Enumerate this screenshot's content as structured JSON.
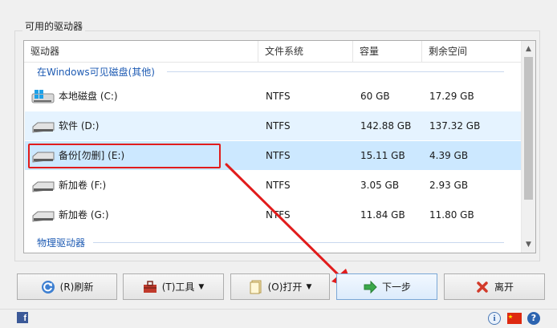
{
  "groupbox": {
    "title": "可用的驱动器"
  },
  "columns": {
    "drive": "驱动器",
    "filesystem": "文件系统",
    "capacity": "容量",
    "free": "剩余空间"
  },
  "groups": {
    "windows": "在Windows可见磁盘(其他)",
    "physical": "物理驱动器"
  },
  "drives": [
    {
      "name": "本地磁盘 (C:)",
      "fs": "NTFS",
      "capacity": "60 GB",
      "free": "17.29 GB",
      "icon": "windows-drive-icon"
    },
    {
      "name": "软件 (D:)",
      "fs": "NTFS",
      "capacity": "142.88 GB",
      "free": "137.32 GB",
      "icon": "hard-drive-icon"
    },
    {
      "name": "备份[勿删] (E:)",
      "fs": "NTFS",
      "capacity": "15.11 GB",
      "free": "4.39 GB",
      "icon": "hard-drive-icon"
    },
    {
      "name": "新加卷 (F:)",
      "fs": "NTFS",
      "capacity": "3.05 GB",
      "free": "2.93 GB",
      "icon": "hard-drive-icon"
    },
    {
      "name": "新加卷 (G:)",
      "fs": "NTFS",
      "capacity": "11.84 GB",
      "free": "11.80 GB",
      "icon": "hard-drive-icon"
    }
  ],
  "buttons": {
    "refresh": "(R)刷新",
    "tools": "(T)工具",
    "open": "(O)打开",
    "next": "下一步",
    "exit": "离开"
  },
  "colors": {
    "selection": "#cce8ff",
    "hover": "#e5f3ff",
    "group_text": "#1e5bb3",
    "annotation": "#e11c1c"
  }
}
